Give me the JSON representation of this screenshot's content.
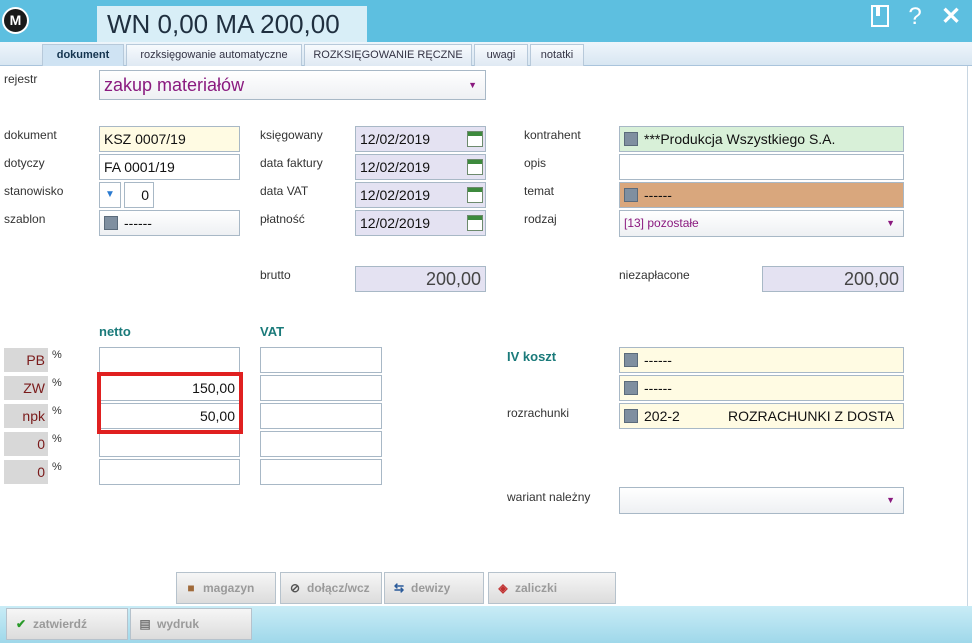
{
  "header": {
    "logo_letter": "M",
    "title": "WN 0,00 MA 200,00",
    "icons": [
      "book-icon",
      "help-icon",
      "close-icon"
    ],
    "help_glyph": "?",
    "close_glyph": "✕"
  },
  "tabs": [
    {
      "label": "dokument",
      "active": true
    },
    {
      "label": "rozksięgowanie automatyczne",
      "active": false
    },
    {
      "label": "ROZKSIĘGOWANIE RĘCZNE",
      "active": false
    },
    {
      "label": "uwagi",
      "active": false
    },
    {
      "label": "notatki",
      "active": false
    }
  ],
  "form": {
    "rejestr": {
      "label": "rejestr",
      "value": "zakup materiałów"
    },
    "dokument": {
      "label": "dokument",
      "value": "KSZ 0007/19"
    },
    "dotyczy": {
      "label": "dotyczy",
      "value": "FA 0001/19"
    },
    "stanowisko": {
      "label": "stanowisko",
      "value": "0"
    },
    "szablon": {
      "label": "szablon",
      "value": "------"
    },
    "ksiegowany": {
      "label": "księgowany",
      "value": "12/02/2019"
    },
    "data_faktury": {
      "label": "data faktury",
      "value": "12/02/2019"
    },
    "data_vat": {
      "label": "data VAT",
      "value": "12/02/2019"
    },
    "platnosc": {
      "label": "płatność",
      "value": "12/02/2019"
    },
    "kontrahent": {
      "label": "kontrahent",
      "value": "***Produkcja Wszystkiego S.A."
    },
    "opis": {
      "label": "opis",
      "value": ""
    },
    "temat": {
      "label": "temat",
      "value": "------"
    },
    "rodzaj": {
      "label": "rodzaj",
      "value": "[13] pozostałe"
    },
    "brutto": {
      "label": "brutto",
      "value": "200,00"
    },
    "niezaplacone": {
      "label": "niezapłacone",
      "value": "200,00"
    }
  },
  "vat_section": {
    "netto_header": "netto",
    "vat_header": "VAT",
    "percent_sign": "%",
    "rows": [
      {
        "rate": "PB",
        "netto": "",
        "vat": ""
      },
      {
        "rate": "ZW",
        "netto": "150,00",
        "vat": ""
      },
      {
        "rate": "npk",
        "netto": "50,00",
        "vat": ""
      },
      {
        "rate": "0",
        "netto": "",
        "vat": ""
      },
      {
        "rate": "0",
        "netto": "",
        "vat": ""
      }
    ]
  },
  "koszt": {
    "label": "IV koszt",
    "value1": "------",
    "value2": "------",
    "rozrachunki_label": "rozrachunki",
    "rozrachunki_code": "202-2",
    "rozrachunki_name": "ROZRACHUNKI Z DOSTA",
    "wariant_label": "wariant należny",
    "wariant_value": ""
  },
  "buttons": {
    "magazyn": "magazyn",
    "dolacz": "dołącz/wcz",
    "dewizy": "dewizy",
    "zaliczki": "zaliczki",
    "zatwierdz": "zatwierdź",
    "wydruk": "wydruk"
  },
  "colors": {
    "header": "#5dbfe0",
    "section_heading": "#1a7a7a",
    "highlight": "#e02020",
    "dropdown_text": "#8a1a7f"
  }
}
